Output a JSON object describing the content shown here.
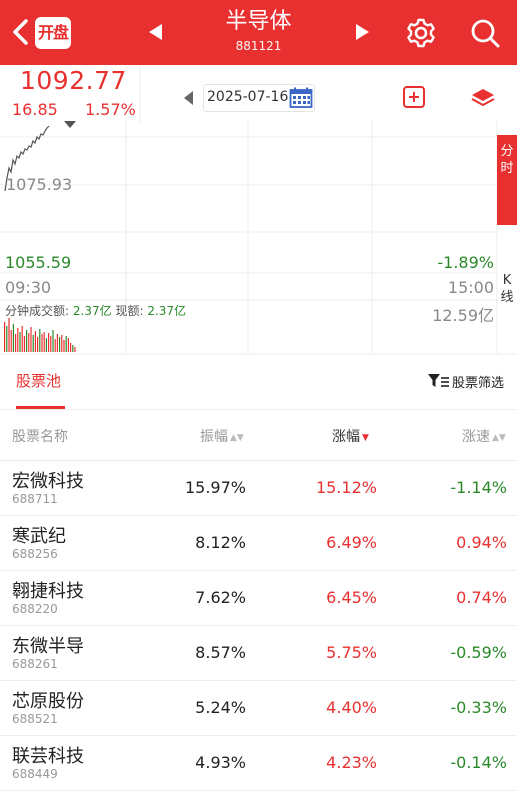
{
  "header": {
    "open_badge": "开盘",
    "title": "半导体",
    "code": "881121"
  },
  "quote": {
    "price": "1092.77",
    "change": "16.85",
    "change_pct": "1.57%",
    "date": "2025-07-16"
  },
  "chart": {
    "high_label": "1075.93",
    "low_label": "1055.59",
    "low_pct": "-1.89%",
    "time_start": "09:30",
    "time_end": "15:00",
    "volume_prefix": "分钟成交额:",
    "volume_value": "2.37亿",
    "current_prefix": "现额:",
    "current_value": "2.37亿",
    "volume_max": "12.59亿"
  },
  "side_tabs": {
    "fenshi": "分时",
    "kline": "K线"
  },
  "pool": {
    "tab_label": "股票池",
    "filter_label": "股票筛选"
  },
  "table": {
    "headers": {
      "name": "股票名称",
      "amplitude": "振幅",
      "change": "涨幅",
      "speed": "涨速"
    },
    "rows": [
      {
        "name": "宏微科技",
        "code": "688711",
        "amplitude": "15.97%",
        "change": "15.12%",
        "speed": "-1.14%",
        "speed_dir": "down"
      },
      {
        "name": "寒武纪",
        "code": "688256",
        "amplitude": "8.12%",
        "change": "6.49%",
        "speed": "0.94%",
        "speed_dir": "up"
      },
      {
        "name": "翱捷科技",
        "code": "688220",
        "amplitude": "7.62%",
        "change": "6.45%",
        "speed": "0.74%",
        "speed_dir": "up"
      },
      {
        "name": "东微半导",
        "code": "688261",
        "amplitude": "8.57%",
        "change": "5.75%",
        "speed": "-0.59%",
        "speed_dir": "down"
      },
      {
        "name": "芯原股份",
        "code": "688521",
        "amplitude": "5.24%",
        "change": "4.40%",
        "speed": "-0.33%",
        "speed_dir": "down"
      },
      {
        "name": "联芸科技",
        "code": "688449",
        "amplitude": "4.93%",
        "change": "4.23%",
        "speed": "-0.14%",
        "speed_dir": "down"
      }
    ]
  },
  "colors": {
    "accent": "#e93030",
    "down": "#2a8a2a"
  }
}
